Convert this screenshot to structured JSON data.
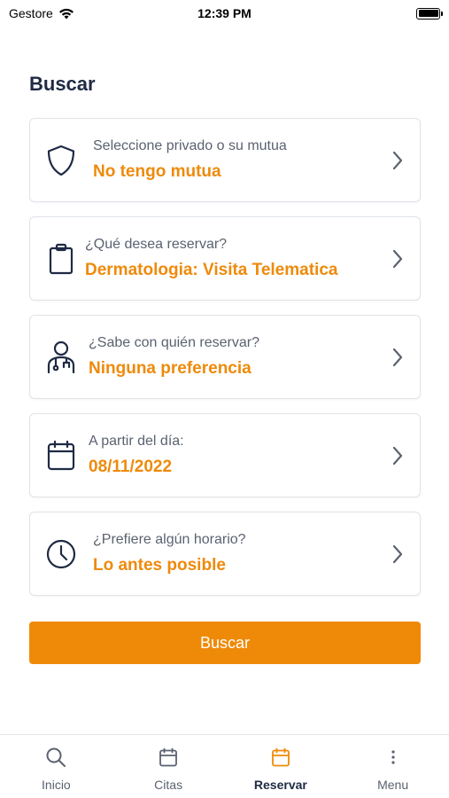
{
  "status_bar": {
    "carrier": "Gestore",
    "time": "12:39 PM"
  },
  "page": {
    "title": "Buscar"
  },
  "cards": [
    {
      "label": "Seleccione privado o su mutua",
      "value": "No tengo mutua",
      "icon": "shield-icon"
    },
    {
      "label": "¿Qué desea reservar?",
      "value": "Dermatologia: Visita Telematica",
      "icon": "clipboard-icon"
    },
    {
      "label": "¿Sabe con quién reservar?",
      "value": "Ninguna preferencia",
      "icon": "doctor-icon"
    },
    {
      "label": "A partir del día:",
      "value": "08/11/2022",
      "icon": "calendar-icon"
    },
    {
      "label": "¿Prefiere algún horario?",
      "value": "Lo antes posible",
      "icon": "clock-icon"
    }
  ],
  "search_button": {
    "label": "Buscar"
  },
  "tabs": [
    {
      "label": "Inicio",
      "icon": "search-icon"
    },
    {
      "label": "Citas",
      "icon": "calendar-icon"
    },
    {
      "label": "Reservar",
      "icon": "calendar-icon"
    },
    {
      "label": "Menu",
      "icon": "more-vertical-icon"
    }
  ],
  "active_tab": "Reservar",
  "colors": {
    "accent": "#ef8a08",
    "value_text": "#ee8a0b",
    "heading": "#1f2a44",
    "muted": "#5a6270",
    "card_border": "#dfe3e8"
  }
}
